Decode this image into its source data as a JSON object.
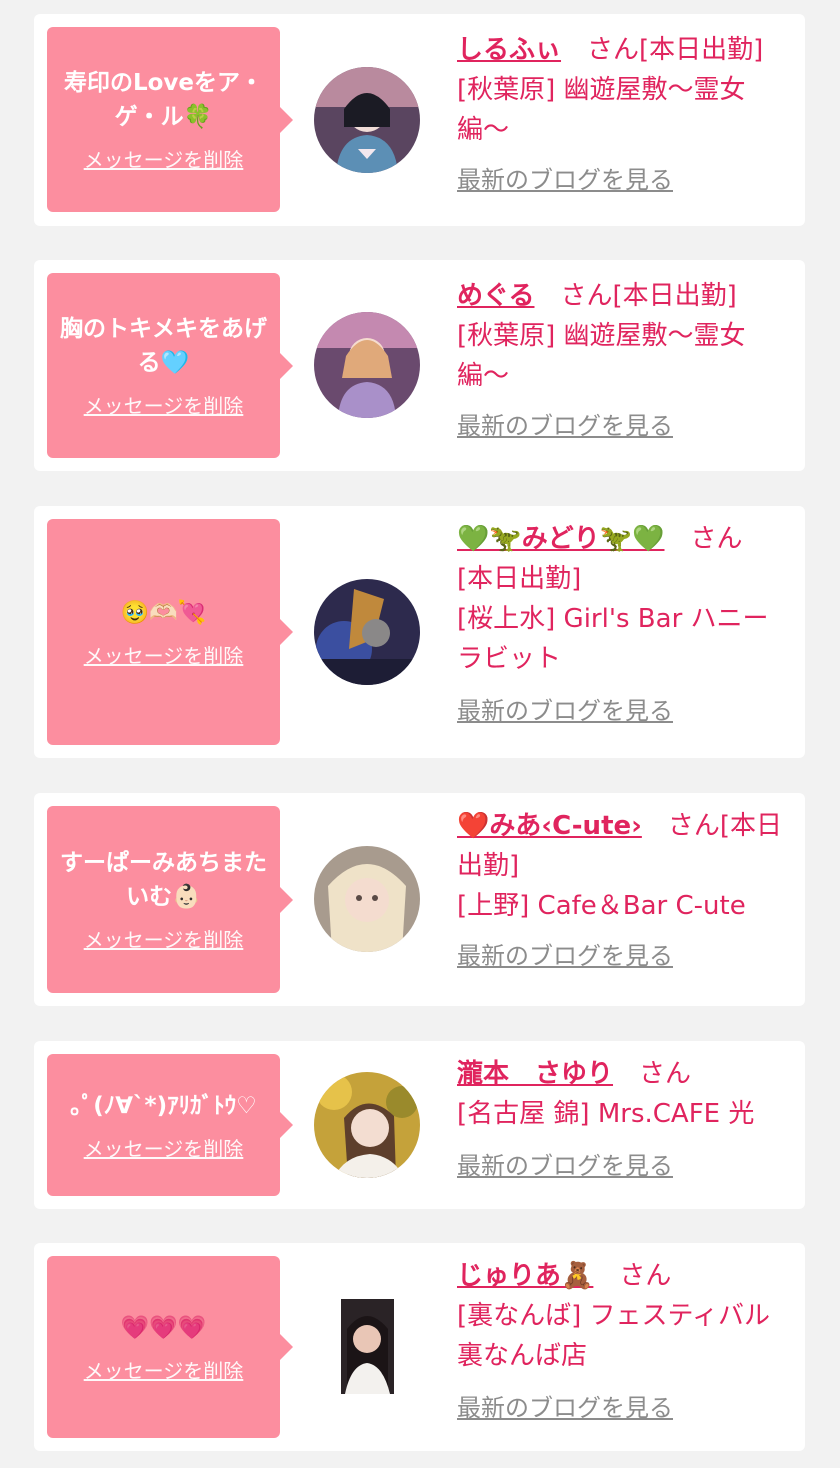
{
  "common": {
    "delete_label": "メッセージを削除",
    "blog_label": "最新のブログを見る",
    "san": "さん"
  },
  "cards": [
    {
      "message": "寿印のLoveをア・ゲ・ル🍀",
      "name": "しるふぃ",
      "status": "[本日出勤]",
      "shop": "[秋葉原] 幽遊屋敷〜霊女編〜",
      "avatar_icon": "avatar-photo"
    },
    {
      "message": "胸のトキメキをあげる🩵",
      "name": "めぐる",
      "status": "[本日出勤]",
      "shop": "[秋葉原] 幽遊屋敷〜霊女編〜",
      "avatar_icon": "avatar-photo"
    },
    {
      "message": "🥹🫶🏻💘",
      "name": "💚🦖みどり🦖💚",
      "status": "[本日出勤]",
      "shop": "[桜上水] Girl's Bar ハニーラビット",
      "avatar_icon": "avatar-photo"
    },
    {
      "message": "すーぱーみあちまたいむ👶🏻",
      "name": "❤️みあ‹C-ute›",
      "status": "[本日出勤]",
      "shop": "[上野] Cafe＆Bar C-ute",
      "avatar_icon": "avatar-photo"
    },
    {
      "message": "｡ﾟ(ﾉ∀`*)ｱﾘｶﾞﾄｳ♡",
      "name": "瀧本　さゆり",
      "status": "",
      "shop": "[名古屋 錦] Mrs.CAFE 光",
      "avatar_icon": "avatar-photo"
    },
    {
      "message": "💗💗💗",
      "name": "じゅりあ🧸",
      "status": "",
      "shop": "[裏なんば] フェスティバル裏なんば店",
      "avatar_icon": "avatar-photo"
    }
  ],
  "colors": {
    "accent": "#e0245e",
    "bubble": "#fc8e9f",
    "background": "#f2f2f2"
  }
}
